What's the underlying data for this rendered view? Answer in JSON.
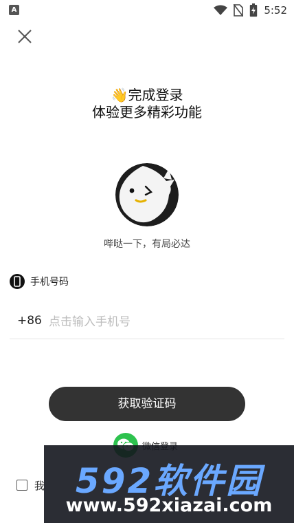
{
  "status_bar": {
    "app_icon": "A",
    "time": "5:52",
    "icons": [
      "wifi-icon",
      "no-sim-icon",
      "battery-charging-icon"
    ]
  },
  "header": {
    "close_icon": "close-icon",
    "emoji": "👋",
    "title_line1": "完成登录",
    "title_line2": "体验更多精彩功能"
  },
  "avatar": {
    "icon": "ghost-mascot-icon"
  },
  "slogan": "哔哒一下，有局必达",
  "phone": {
    "label": "手机号码",
    "label_icon": "phone-icon",
    "country_code": "+86",
    "placeholder": "点击输入手机号",
    "value": ""
  },
  "get_code_button": "获取验证码",
  "wechat": {
    "label": "微信登录",
    "icon": "wechat-icon",
    "color": "#2dc24e"
  },
  "agreement": {
    "text": "我",
    "checked": false
  },
  "watermark": {
    "title": "592软件园",
    "url": "www.592xiazai.com"
  },
  "colors": {
    "button_bg": "#333333",
    "background": "#ffffff"
  }
}
